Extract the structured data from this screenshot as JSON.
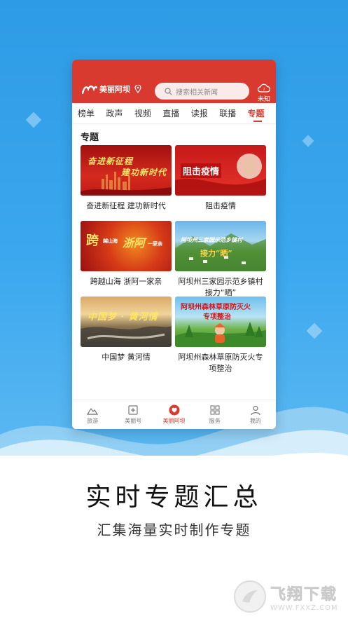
{
  "app": {
    "logo_text": "美丽阿坝",
    "search_placeholder": "搜索相关新闻",
    "weather_text": "未知"
  },
  "tabs": [
    {
      "label": "榜单"
    },
    {
      "label": "政声"
    },
    {
      "label": "视频"
    },
    {
      "label": "直播"
    },
    {
      "label": "读报"
    },
    {
      "label": "联播"
    },
    {
      "label": "专题",
      "active": true
    }
  ],
  "section_title": "专题",
  "cards": [
    {
      "title": "奋进新征程 建功新时代",
      "thumb_text": [
        "奋进新征程",
        "建功新时代"
      ]
    },
    {
      "title": "阻击疫情",
      "thumb_text": [
        "阻击疫情"
      ]
    },
    {
      "title": "跨越山海 浙阿一家亲",
      "thumb_text": [
        "跨",
        "越山海",
        "浙阿",
        "一家亲"
      ]
    },
    {
      "title": "阿坝州三家园示范乡镇村接力“晒”",
      "thumb_text": [
        "阿坝州三家园示范乡镇村",
        "接力“晒”"
      ]
    },
    {
      "title": "中国梦 黄河情",
      "thumb_text": [
        "中国梦 · 黄河情"
      ]
    },
    {
      "title": "阿坝州森林草原防灭火专项整治",
      "thumb_text": [
        "阿坝州森林草原防灭火",
        "专项整治"
      ]
    }
  ],
  "bottom_nav": [
    {
      "label": "旅游",
      "icon": "mountain-icon"
    },
    {
      "label": "美丽号",
      "icon": "plus-square-icon"
    },
    {
      "label": "美丽阿坝",
      "icon": "heart-badge-icon",
      "active": true
    },
    {
      "label": "服务",
      "icon": "grid-icon"
    },
    {
      "label": "我的",
      "icon": "user-icon"
    }
  ],
  "promo": {
    "slogan": "实时专题汇总",
    "subtitle": "汇集海量实时制作专题"
  },
  "watermark": {
    "brand": "飞翔下载",
    "url": "WWW.FXXZ.COM"
  },
  "colors": {
    "brand_red": "#d83a2f",
    "background_blue": "#3aa7ee"
  }
}
